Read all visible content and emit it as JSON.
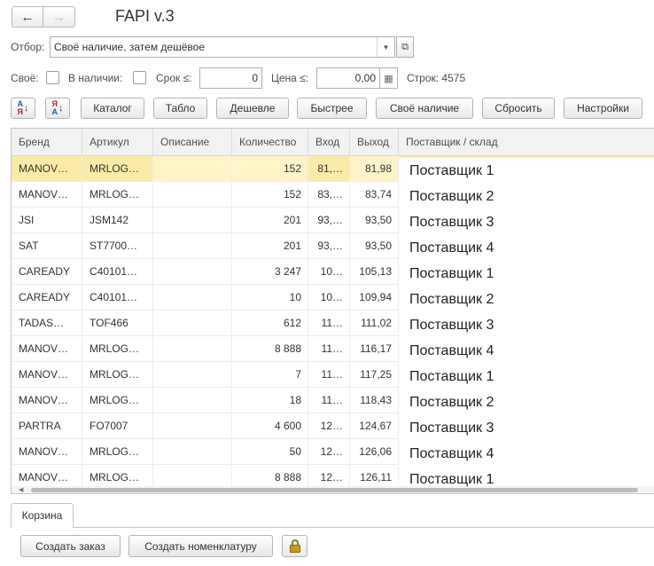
{
  "header": {
    "title": "FAPI v.3",
    "back_icon": "←",
    "forward_icon": "→"
  },
  "filter": {
    "label": "Отбор:",
    "value": "Своё наличие, затем дешёвое",
    "dropdown_icon": "▼",
    "open_icon": "⧉"
  },
  "options": {
    "own_label": "Своё:",
    "own_checked": false,
    "instock_label": "В наличии:",
    "instock_checked": false,
    "term_label": "Срок ≤:",
    "term_value": "0",
    "price_label": "Цена ≤:",
    "price_value": "0,00",
    "calc_icon": "▦",
    "rows_label": "Строк: 4575"
  },
  "toolbar": {
    "sort_asc_icon": "sort-asc-icon",
    "sort_desc_icon": "sort-desc-icon",
    "catalog": "Каталог",
    "board": "Табло",
    "cheaper": "Дешевле",
    "faster": "Быстрее",
    "own_stock": "Своё наличие",
    "reset": "Сбросить",
    "settings": "Настройки"
  },
  "table": {
    "columns": [
      "Бренд",
      "Артикул",
      "Описание",
      "Количество",
      "Вход",
      "Выход",
      "Поставщик / склад"
    ],
    "selected_row": 0,
    "rows": [
      {
        "brand": "MANOV…",
        "article": "MRLOG…",
        "desc": "",
        "qty": "152",
        "in": "81,…",
        "out": "81,98",
        "supplier": "Поставщик 1"
      },
      {
        "brand": "MANOV…",
        "article": "MRLOG…",
        "desc": "",
        "qty": "152",
        "in": "83,…",
        "out": "83,74",
        "supplier": "Поставщик 2"
      },
      {
        "brand": "JSI",
        "article": "JSM142",
        "desc": "",
        "qty": "201",
        "in": "93,…",
        "out": "93,50",
        "supplier": "Поставщик 3"
      },
      {
        "brand": "SAT",
        "article": "ST7700…",
        "desc": "",
        "qty": "201",
        "in": "93,…",
        "out": "93,50",
        "supplier": "Поставщик 4"
      },
      {
        "brand": "CAREADY",
        "article": "C40101…",
        "desc": "",
        "qty": "3 247",
        "in": "10…",
        "out": "105,13",
        "supplier": "Поставщик 1"
      },
      {
        "brand": "CAREADY",
        "article": "C40101…",
        "desc": "",
        "qty": "10",
        "in": "10…",
        "out": "109,94",
        "supplier": "Поставщик 2"
      },
      {
        "brand": "TADAS…",
        "article": "TOF466",
        "desc": "",
        "qty": "612",
        "in": "11…",
        "out": "111,02",
        "supplier": "Поставщик 3"
      },
      {
        "brand": "MANOV…",
        "article": "MRLOG…",
        "desc": "",
        "qty": "8 888",
        "in": "11…",
        "out": "116,17",
        "supplier": "Поставщик 4"
      },
      {
        "brand": "MANOV…",
        "article": "MRLOG…",
        "desc": "",
        "qty": "7",
        "in": "11…",
        "out": "117,25",
        "supplier": "Поставщик 1"
      },
      {
        "brand": "MANOV…",
        "article": "MRLOG…",
        "desc": "",
        "qty": "18",
        "in": "11…",
        "out": "118,43",
        "supplier": "Поставщик 2"
      },
      {
        "brand": "PARTRA",
        "article": "FO7007",
        "desc": "",
        "qty": "4 600",
        "in": "12…",
        "out": "124,67",
        "supplier": "Поставщик 3"
      },
      {
        "brand": "MANOV…",
        "article": "MRLOG…",
        "desc": "",
        "qty": "50",
        "in": "12…",
        "out": "126,06",
        "supplier": "Поставщик 4"
      },
      {
        "brand": "MANOV…",
        "article": "MRLOG…",
        "desc": "",
        "qty": "8 888",
        "in": "12…",
        "out": "126,11",
        "supplier": "Поставщик 1"
      }
    ]
  },
  "tabs": {
    "cart": "Корзина"
  },
  "bottom": {
    "create_order": "Создать заказ",
    "create_item": "Создать номенклатуру",
    "lock_icon": "lock-icon"
  }
}
